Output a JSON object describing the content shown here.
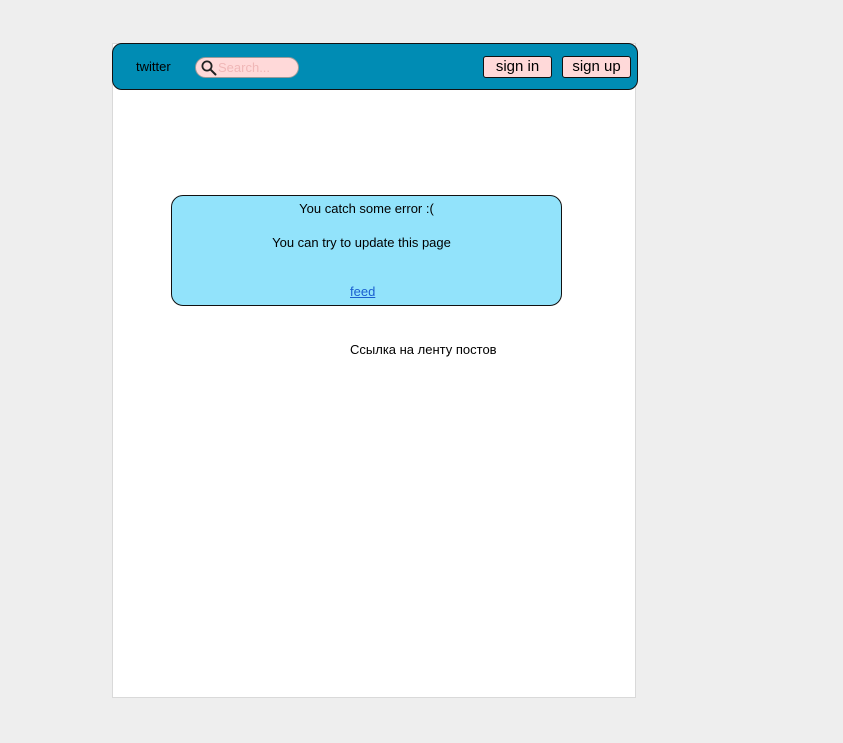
{
  "header": {
    "brand": "twitter",
    "search": {
      "placeholder": "Search..."
    },
    "sign_in_label": "sign in",
    "sign_up_label": "sign up"
  },
  "error": {
    "title": "You catch some error :(",
    "message": "You can try to update this page",
    "link_label": "feed"
  },
  "caption": "Ссылка на ленту постов",
  "colors": {
    "page_background": "#eeeeee",
    "navbar": "#008cb4",
    "button": "#ffd9d9",
    "error_box": "#92e3fb",
    "link": "#1a5fd0"
  },
  "icons": {
    "search": "search-icon"
  }
}
